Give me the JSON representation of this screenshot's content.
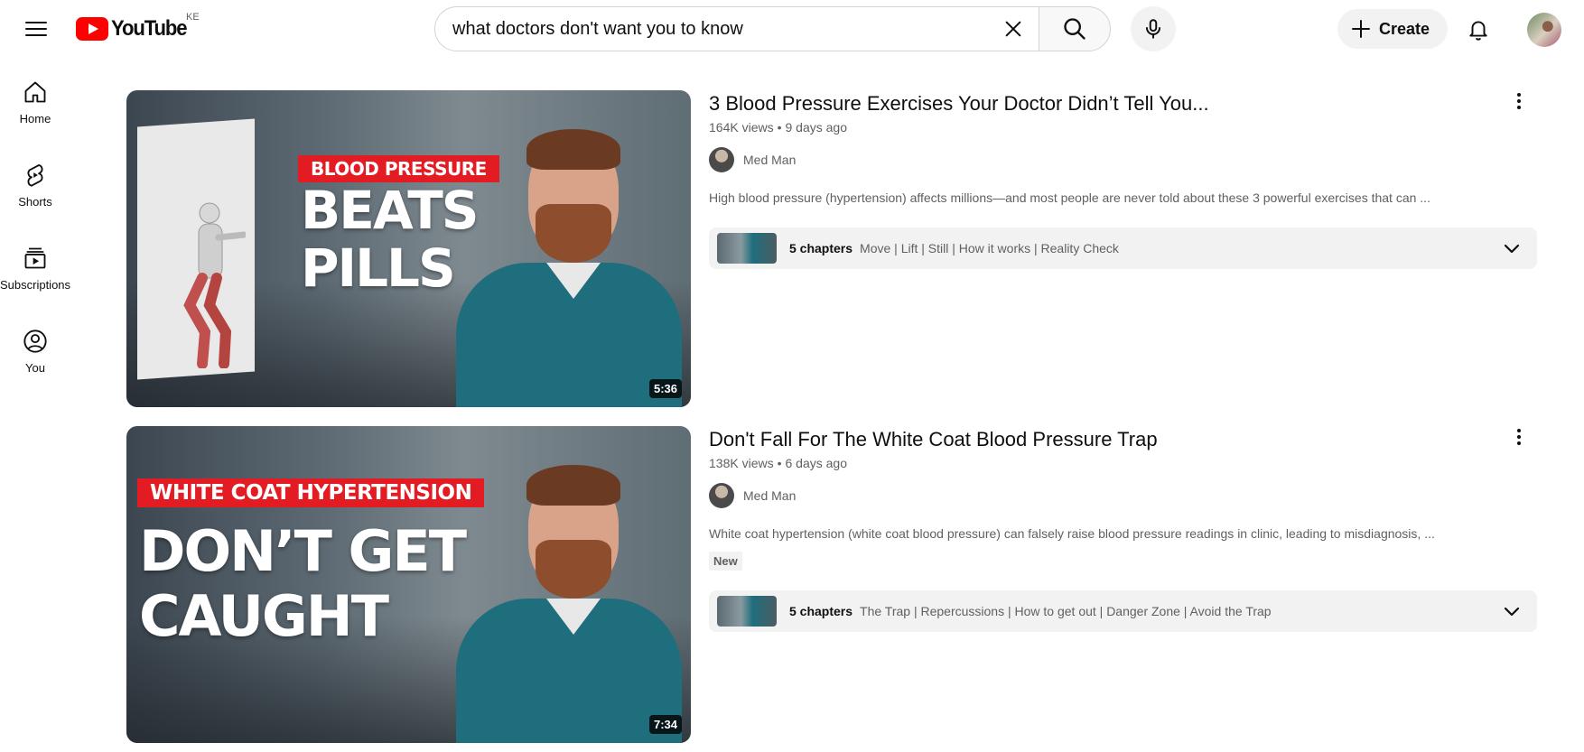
{
  "header": {
    "logo_text": "YouTube",
    "country_code": "KE",
    "search_value": "what doctors don't want you to know",
    "create_label": "Create"
  },
  "sidenav": {
    "items": [
      {
        "label": "Home",
        "icon": "home-icon"
      },
      {
        "label": "Shorts",
        "icon": "shorts-icon"
      },
      {
        "label": "Subscriptions",
        "icon": "subscriptions-icon"
      },
      {
        "label": "You",
        "icon": "you-icon"
      }
    ]
  },
  "videos": [
    {
      "title": "3 Blood Pressure Exercises Your Doctor Didn’t Tell You...",
      "views": "164K views",
      "age": "9 days ago",
      "channel": "Med Man",
      "description": "High blood pressure (hypertension) affects millions—and most people are never told about these 3 powerful exercises that can ...",
      "duration": "5:36",
      "thumb_badge": "BLOOD PRESSURE",
      "thumb_line1": "BEATS",
      "thumb_line2": "PILLS",
      "chapters_count": "5 chapters",
      "chapters_list": "Move | Lift | Still | How it works | Reality Check"
    },
    {
      "title": "Don't Fall For The White Coat Blood Pressure Trap",
      "views": "138K views",
      "age": "6 days ago",
      "channel": "Med Man",
      "description": "White coat hypertension (white coat blood pressure) can falsely raise blood pressure readings in clinic, leading to misdiagnosis, ...",
      "badge": "New",
      "duration": "7:34",
      "thumb_badge": "WHITE COAT HYPERTENSION",
      "thumb_line1": "DON’T GET",
      "thumb_line2": "CAUGHT",
      "chapters_count": "5 chapters",
      "chapters_list": "The Trap | Repercussions | How to get out | Danger Zone | Avoid the Trap"
    }
  ],
  "colors": {
    "brand_red": "#ff0000",
    "thumb_red": "#e31b23",
    "scrubs_teal": "#1f6e7d"
  }
}
